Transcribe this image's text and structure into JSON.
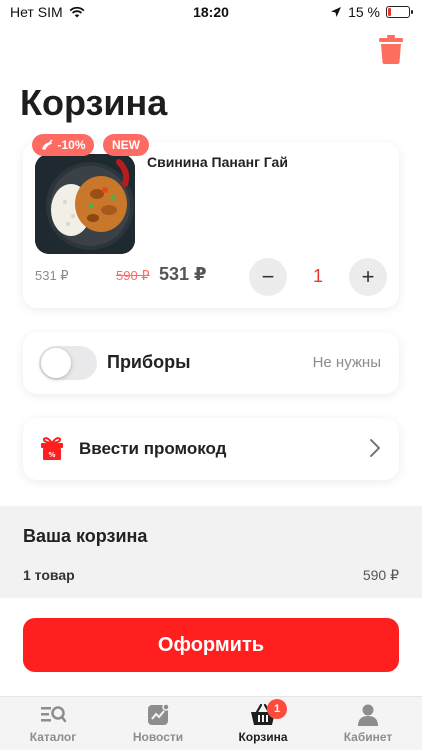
{
  "status_bar": {
    "carrier": "Нет SIM",
    "time": "18:20",
    "battery_text": "15 %",
    "battery_level": 0.15
  },
  "page": {
    "title": "Корзина"
  },
  "cart_item": {
    "name": "Свинина Пананг Гай",
    "badge_discount": "-10%",
    "badge_new": "NEW",
    "price_base": "531 ₽",
    "price_old": "590 ₽",
    "price_new": "531 ₽",
    "quantity": "1",
    "minus_label": "−",
    "plus_label": "+"
  },
  "cutlery": {
    "label": "Приборы",
    "value": "Не нужны",
    "enabled": false
  },
  "promo": {
    "label": "Ввести промокод"
  },
  "summary": {
    "title": "Ваша корзина",
    "count": "1 товар",
    "total": "590 ₽"
  },
  "checkout": {
    "label": "Оформить"
  },
  "tabbar": {
    "tabs": [
      {
        "label": "Каталог",
        "icon": "catalog-search-icon"
      },
      {
        "label": "Новости",
        "icon": "news-chart-icon"
      },
      {
        "label": "Корзина",
        "icon": "basket-icon",
        "badge": "1",
        "active": true
      },
      {
        "label": "Кабинет",
        "icon": "user-icon"
      }
    ]
  },
  "colors": {
    "accent": "#ff1f1f",
    "badge": "#ff6b63",
    "trash": "#ff6f61"
  }
}
